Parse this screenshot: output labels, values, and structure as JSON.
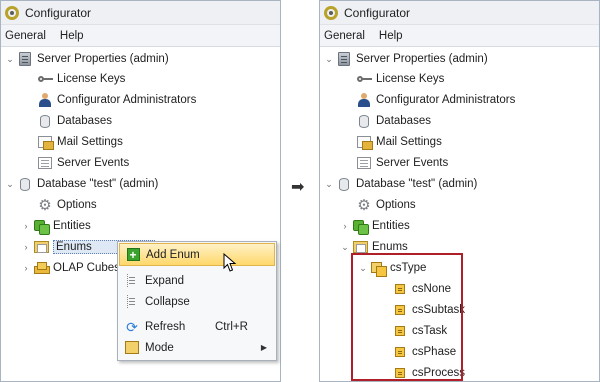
{
  "left": {
    "window_title": "Configurator",
    "menu": [
      "General",
      "Help"
    ],
    "tree": {
      "server_properties": "Server Properties (admin)",
      "license_keys": "License Keys",
      "configurator_admins": "Configurator Administrators",
      "databases": "Databases",
      "mail_settings": "Mail Settings",
      "server_events": "Server Events",
      "database": "Database \"test\" (admin)",
      "options": "Options",
      "entities": "Entities",
      "enums": "Enums",
      "olap_cubes": "OLAP Cubes"
    },
    "context_menu": {
      "add_enum": "Add Enum",
      "expand": "Expand",
      "collapse": "Collapse",
      "refresh": "Refresh",
      "refresh_shortcut": "Ctrl+R",
      "mode": "Mode"
    }
  },
  "right": {
    "window_title": "Configurator",
    "menu": [
      "General",
      "Help"
    ],
    "tree": {
      "server_properties": "Server Properties (admin)",
      "license_keys": "License Keys",
      "configurator_admins": "Configurator Administrators",
      "databases": "Databases",
      "mail_settings": "Mail Settings",
      "server_events": "Server Events",
      "database": "Database \"test\" (admin)",
      "options": "Options",
      "entities": "Entities",
      "enums": "Enums",
      "cs_type": "csType",
      "cs_items": [
        "csNone",
        "csSubtask",
        "csTask",
        "csPhase",
        "csProcess"
      ]
    }
  },
  "colors": {
    "highlight_box": "#b01f27",
    "menu_highlight": "#ffd86b",
    "selection": "#dfe8f5"
  }
}
